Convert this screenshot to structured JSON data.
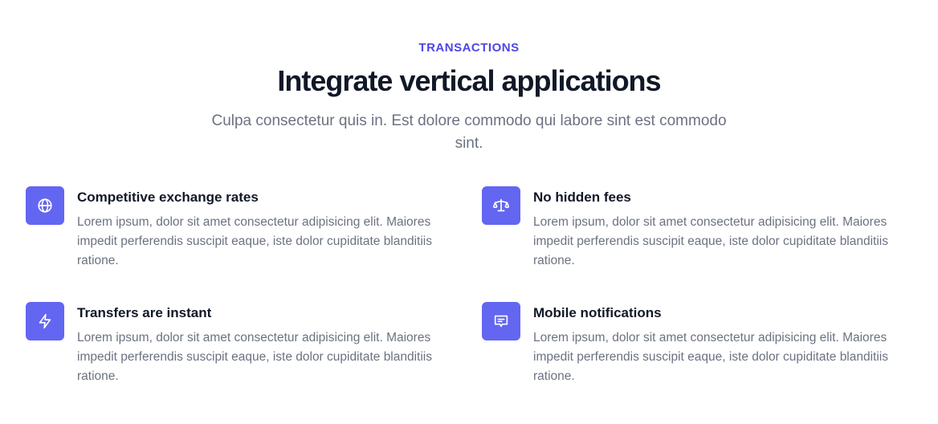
{
  "header": {
    "eyebrow": "TRANSACTIONS",
    "title": "Integrate vertical applications",
    "subtitle": "Culpa consectetur quis in. Est dolore commodo qui labore sint est commodo sint."
  },
  "colors": {
    "accent": "#4f46e5",
    "icon_bg": "#6366f1",
    "heading": "#111827",
    "body_text": "#6b7280"
  },
  "features": [
    {
      "icon": "globe-icon",
      "title": "Competitive exchange rates",
      "description": "Lorem ipsum, dolor sit amet consectetur adipisicing elit. Maiores impedit perferendis suscipit eaque, iste dolor cupiditate blanditiis ratione."
    },
    {
      "icon": "scale-icon",
      "title": "No hidden fees",
      "description": "Lorem ipsum, dolor sit amet consectetur adipisicing elit. Maiores impedit perferendis suscipit eaque, iste dolor cupiditate blanditiis ratione."
    },
    {
      "icon": "lightning-bolt-icon",
      "title": "Transfers are instant",
      "description": "Lorem ipsum, dolor sit amet consectetur adipisicing elit. Maiores impedit perferendis suscipit eaque, iste dolor cupiditate blanditiis ratione."
    },
    {
      "icon": "chat-alt-icon",
      "title": "Mobile notifications",
      "description": "Lorem ipsum, dolor sit amet consectetur adipisicing elit. Maiores impedit perferendis suscipit eaque, iste dolor cupiditate blanditiis ratione."
    }
  ]
}
